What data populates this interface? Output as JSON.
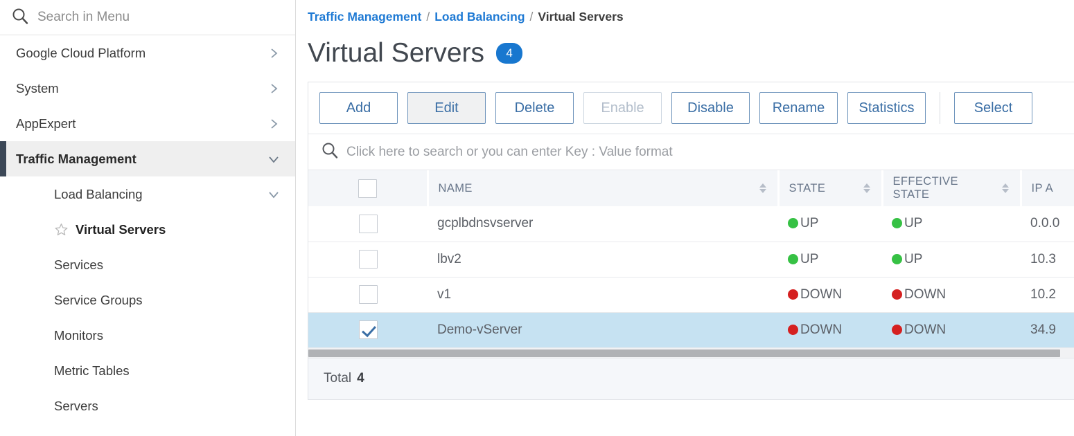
{
  "sidebar": {
    "search": {
      "placeholder": "Search in Menu",
      "value": "",
      "icon": "search-icon"
    },
    "items": [
      {
        "label": "Google Cloud Platform",
        "level": 1,
        "chevron": "chevron-right",
        "state": "collapsed"
      },
      {
        "label": "System",
        "level": 1,
        "chevron": "chevron-right",
        "state": "collapsed"
      },
      {
        "label": "AppExpert",
        "level": 1,
        "chevron": "chevron-right",
        "state": "collapsed"
      },
      {
        "label": "Traffic Management",
        "level": 1,
        "chevron": "chevron-down",
        "state": "expanded-active"
      },
      {
        "label": "Load Balancing",
        "level": 2,
        "chevron": "chevron-down",
        "state": "expanded"
      },
      {
        "label": "Virtual Servers",
        "level": 3,
        "chevron": "",
        "state": "current",
        "icon": "star-outline-icon"
      },
      {
        "label": "Services",
        "level": 3,
        "chevron": "",
        "state": "normal"
      },
      {
        "label": "Service Groups",
        "level": 3,
        "chevron": "",
        "state": "normal"
      },
      {
        "label": "Monitors",
        "level": 3,
        "chevron": "",
        "state": "normal"
      },
      {
        "label": "Metric Tables",
        "level": 3,
        "chevron": "",
        "state": "normal"
      },
      {
        "label": "Servers",
        "level": 3,
        "chevron": "",
        "state": "normal"
      }
    ]
  },
  "breadcrumb": {
    "items": [
      "Traffic Management",
      "Load Balancing",
      "Virtual Servers"
    ],
    "separator": "/"
  },
  "page": {
    "title": "Virtual Servers",
    "count_badge": "4"
  },
  "toolbar": {
    "buttons": [
      {
        "label": "Add",
        "state": "enabled"
      },
      {
        "label": "Edit",
        "state": "pressed"
      },
      {
        "label": "Delete",
        "state": "enabled"
      },
      {
        "label": "Enable",
        "state": "disabled"
      },
      {
        "label": "Disable",
        "state": "enabled"
      },
      {
        "label": "Rename",
        "state": "enabled"
      },
      {
        "label": "Statistics",
        "state": "enabled"
      },
      {
        "label": "Select",
        "state": "enabled",
        "truncated": true
      }
    ]
  },
  "table_search": {
    "placeholder": "Click here to search or you can enter Key : Value format",
    "value": "",
    "icon": "search-icon"
  },
  "table": {
    "columns": [
      {
        "key": "check",
        "label": "",
        "sortable": false
      },
      {
        "key": "name",
        "label": "NAME",
        "sortable": true
      },
      {
        "key": "state",
        "label": "STATE",
        "sortable": true
      },
      {
        "key": "effective_state",
        "label": "EFFECTIVE STATE",
        "sortable": true
      },
      {
        "key": "ip_address",
        "label": "IP A",
        "sortable": false,
        "truncated": true
      }
    ],
    "header_checkbox": {
      "checked": false
    },
    "rows": [
      {
        "checked": false,
        "name": "gcplbdnsvserver",
        "state": "UP",
        "state_color": "#36c144",
        "effective_state": "UP",
        "effective_color": "#36c144",
        "ip_address": "0.0.0",
        "selected": false
      },
      {
        "checked": false,
        "name": "lbv2",
        "state": "UP",
        "state_color": "#36c144",
        "effective_state": "UP",
        "effective_color": "#36c144",
        "ip_address": "10.3",
        "selected": false
      },
      {
        "checked": false,
        "name": "v1",
        "state": "DOWN",
        "state_color": "#d52020",
        "effective_state": "DOWN",
        "effective_color": "#d52020",
        "ip_address": "10.2",
        "selected": false
      },
      {
        "checked": true,
        "name": "Demo-vServer",
        "state": "DOWN",
        "state_color": "#d52020",
        "effective_state": "DOWN",
        "effective_color": "#d52020",
        "ip_address": "34.9",
        "selected": true
      }
    ],
    "footer": {
      "total_label": "Total",
      "total_value": "4"
    },
    "horizontal_scrollbar": {
      "visible": true
    }
  },
  "colors": {
    "link": "#1f7ad4",
    "badge": "#1877cf",
    "accent_bar": "#3c4857",
    "selected_row": "#c6e2f2",
    "status_up": "#36c144",
    "status_down": "#d52020",
    "button_border": "#6d93bb",
    "button_text": "#3a6ea5"
  }
}
